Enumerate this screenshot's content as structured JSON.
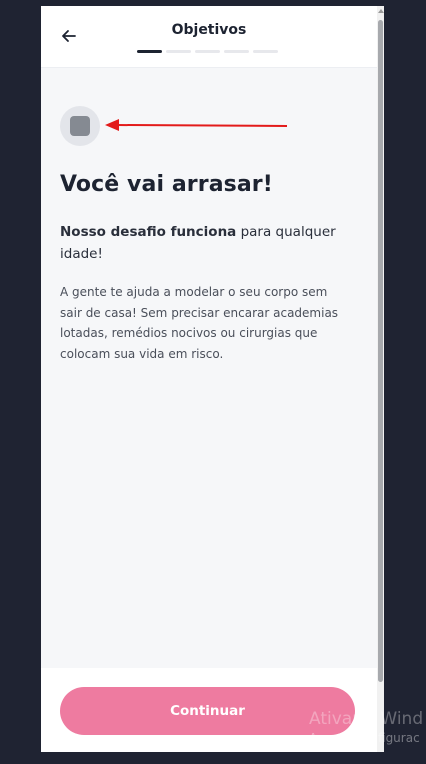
{
  "header": {
    "title": "Objetivos",
    "back_icon": "arrow-left-icon",
    "steps_total": 5,
    "steps_current": 1
  },
  "content": {
    "avatar_icon": "placeholder-avatar-icon",
    "annotation_icon": "red-arrow-annotation",
    "headline": "Você vai arrasar!",
    "lead_bold": "Nosso desafio funciona",
    "lead_rest": " para qualquer idade!",
    "body": "A gente te ajuda a modelar o seu corpo sem sair de casa! Sem precisar encarar academias lotadas, remédios nocivos ou cirurgias que colocam sua vida em risco."
  },
  "footer": {
    "cta_label": "Continuar"
  },
  "watermark": {
    "line1": "Ativar o Wind",
    "line2": "Acesse Configurac"
  },
  "colors": {
    "background": "#1f2332",
    "accent": "#ee7ba0",
    "text": "#1d2331",
    "annotation": "#e31b1b"
  }
}
